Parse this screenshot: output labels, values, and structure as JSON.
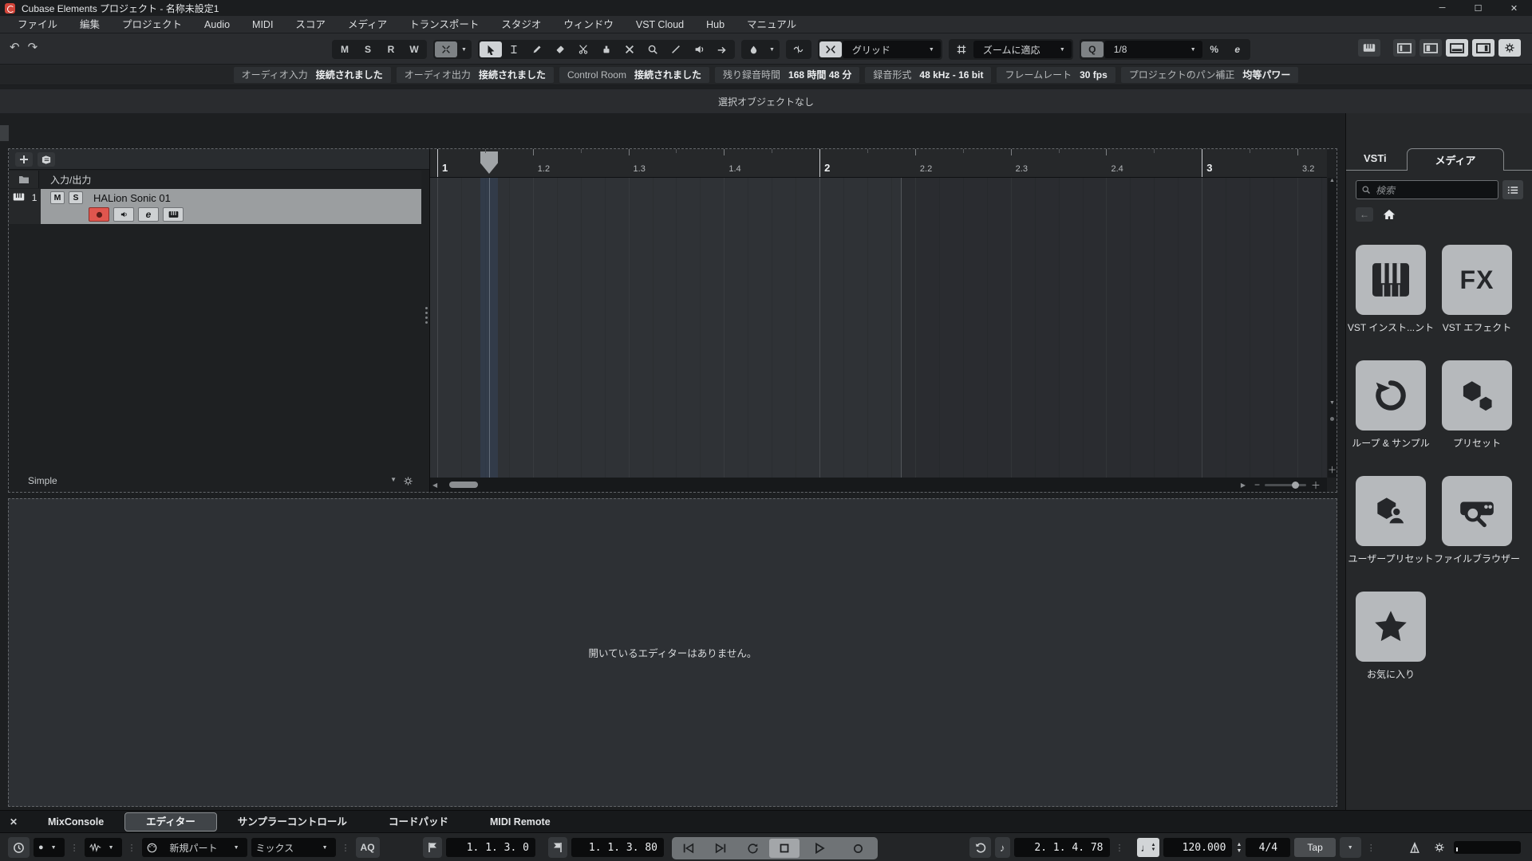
{
  "window": {
    "title": "Cubase Elements プロジェクト - 名称未設定1"
  },
  "menu": {
    "items": [
      "ファイル",
      "編集",
      "プロジェクト",
      "Audio",
      "MIDI",
      "スコア",
      "メディア",
      "トランスポート",
      "スタジオ",
      "ウィンドウ",
      "VST Cloud",
      "Hub",
      "マニュアル"
    ]
  },
  "toolbar": {
    "monitor_buttons": [
      "M",
      "S",
      "R",
      "W"
    ],
    "snap_mode": "グリッド",
    "grid_type": "ズームに適応",
    "quantize_label": "Q",
    "quantize_preset": "1/8",
    "iterative_quantize": "%",
    "quantize_panel": "e"
  },
  "info_bar": {
    "items": [
      {
        "label": "オーディオ入力",
        "value": "接続されました"
      },
      {
        "label": "オーディオ出力",
        "value": "接続されました"
      },
      {
        "label": "Control Room",
        "value": "接続されました"
      },
      {
        "label": "残り録音時間",
        "value": "168 時間 48 分"
      },
      {
        "label": "録音形式",
        "value": "48 kHz - 16 bit"
      },
      {
        "label": "フレームレート",
        "value": "30 fps"
      },
      {
        "label": "プロジェクトのパン補正",
        "value": "均等パワー"
      }
    ]
  },
  "status_line": "選択オブジェクトなし",
  "track_list": {
    "io_label": "入力/出力",
    "track_number": "1",
    "track_name": "HALion Sonic 01",
    "mute": "M",
    "solo": "S",
    "edit": "e",
    "preset_label": "Simple"
  },
  "ruler": {
    "labels": [
      "1",
      "1.2",
      "1.3",
      "1.4",
      "2",
      "2.2",
      "2.3",
      "2.4",
      "3",
      "3.2"
    ],
    "major": [
      "1",
      "2",
      "3"
    ]
  },
  "right_zone": {
    "tab_vsti": "VSTi",
    "tab_media": "メディア",
    "search_placeholder": "検索",
    "tiles": [
      {
        "icon": "piano",
        "label": "VST インスト...ント"
      },
      {
        "icon": "fx",
        "icon_text": "FX",
        "label": "VST エフェクト"
      },
      {
        "icon": "loop",
        "label": "ループ & サンプル"
      },
      {
        "icon": "hexagons",
        "label": "プリセット"
      },
      {
        "icon": "user",
        "label": "ユーザープリセット"
      },
      {
        "icon": "browser",
        "label": "ファイルブラウザー"
      },
      {
        "icon": "star",
        "label": "お気に入り"
      }
    ]
  },
  "bottom_zone": {
    "empty_text": "開いているエディターはありません。"
  },
  "bottom_tabs": {
    "items": [
      "MixConsole",
      "エディター",
      "サンプラーコントロール",
      "コードパッド",
      "MIDI Remote"
    ],
    "active": "エディター"
  },
  "transport": {
    "midi_record_mode": "新規パート",
    "midi_cycle_mode": "ミックス",
    "auto_quantize": "AQ",
    "left_locator": "1. 1. 3. 0",
    "right_locator": "1. 1. 3. 80",
    "position": "2. 1. 4. 78",
    "tempo": "120.000",
    "time_signature": "4/4",
    "tap": "Tap"
  },
  "colors": {
    "record_red": "#e0564e",
    "tile_bg": "#b6b9bc",
    "selected_track": "#9b9ea0",
    "display_bg": "#0b0c0d"
  }
}
